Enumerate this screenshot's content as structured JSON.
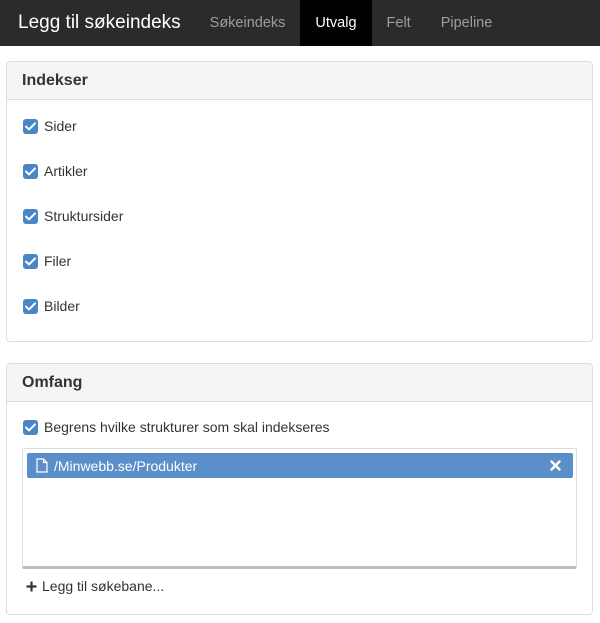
{
  "header": {
    "title": "Legg til søkeindeks",
    "tabs": [
      {
        "label": "Søkeindeks",
        "active": false
      },
      {
        "label": "Utvalg",
        "active": true
      },
      {
        "label": "Felt",
        "active": false
      },
      {
        "label": "Pipeline",
        "active": false
      }
    ]
  },
  "indexes": {
    "heading": "Indekser",
    "options": [
      {
        "label": "Sider",
        "checked": true
      },
      {
        "label": "Artikler",
        "checked": true
      },
      {
        "label": "Struktursider",
        "checked": true
      },
      {
        "label": "Filer",
        "checked": true
      },
      {
        "label": "Bilder",
        "checked": true
      }
    ]
  },
  "scope": {
    "heading": "Omfang",
    "restrict_label": "Begrens hvilke strukturer som skal indekseres",
    "restrict_checked": true,
    "paths": [
      {
        "label": "/Minwebb.se/Produkter",
        "icon": "file-icon",
        "remove_icon": "close-icon"
      }
    ],
    "add_path_label": "Legg til søkebane..."
  },
  "colors": {
    "topbar": "#2b2b2b",
    "active_tab": "#000000",
    "checkbox": "#4a86c5",
    "selected_path": "#5a8fca"
  }
}
